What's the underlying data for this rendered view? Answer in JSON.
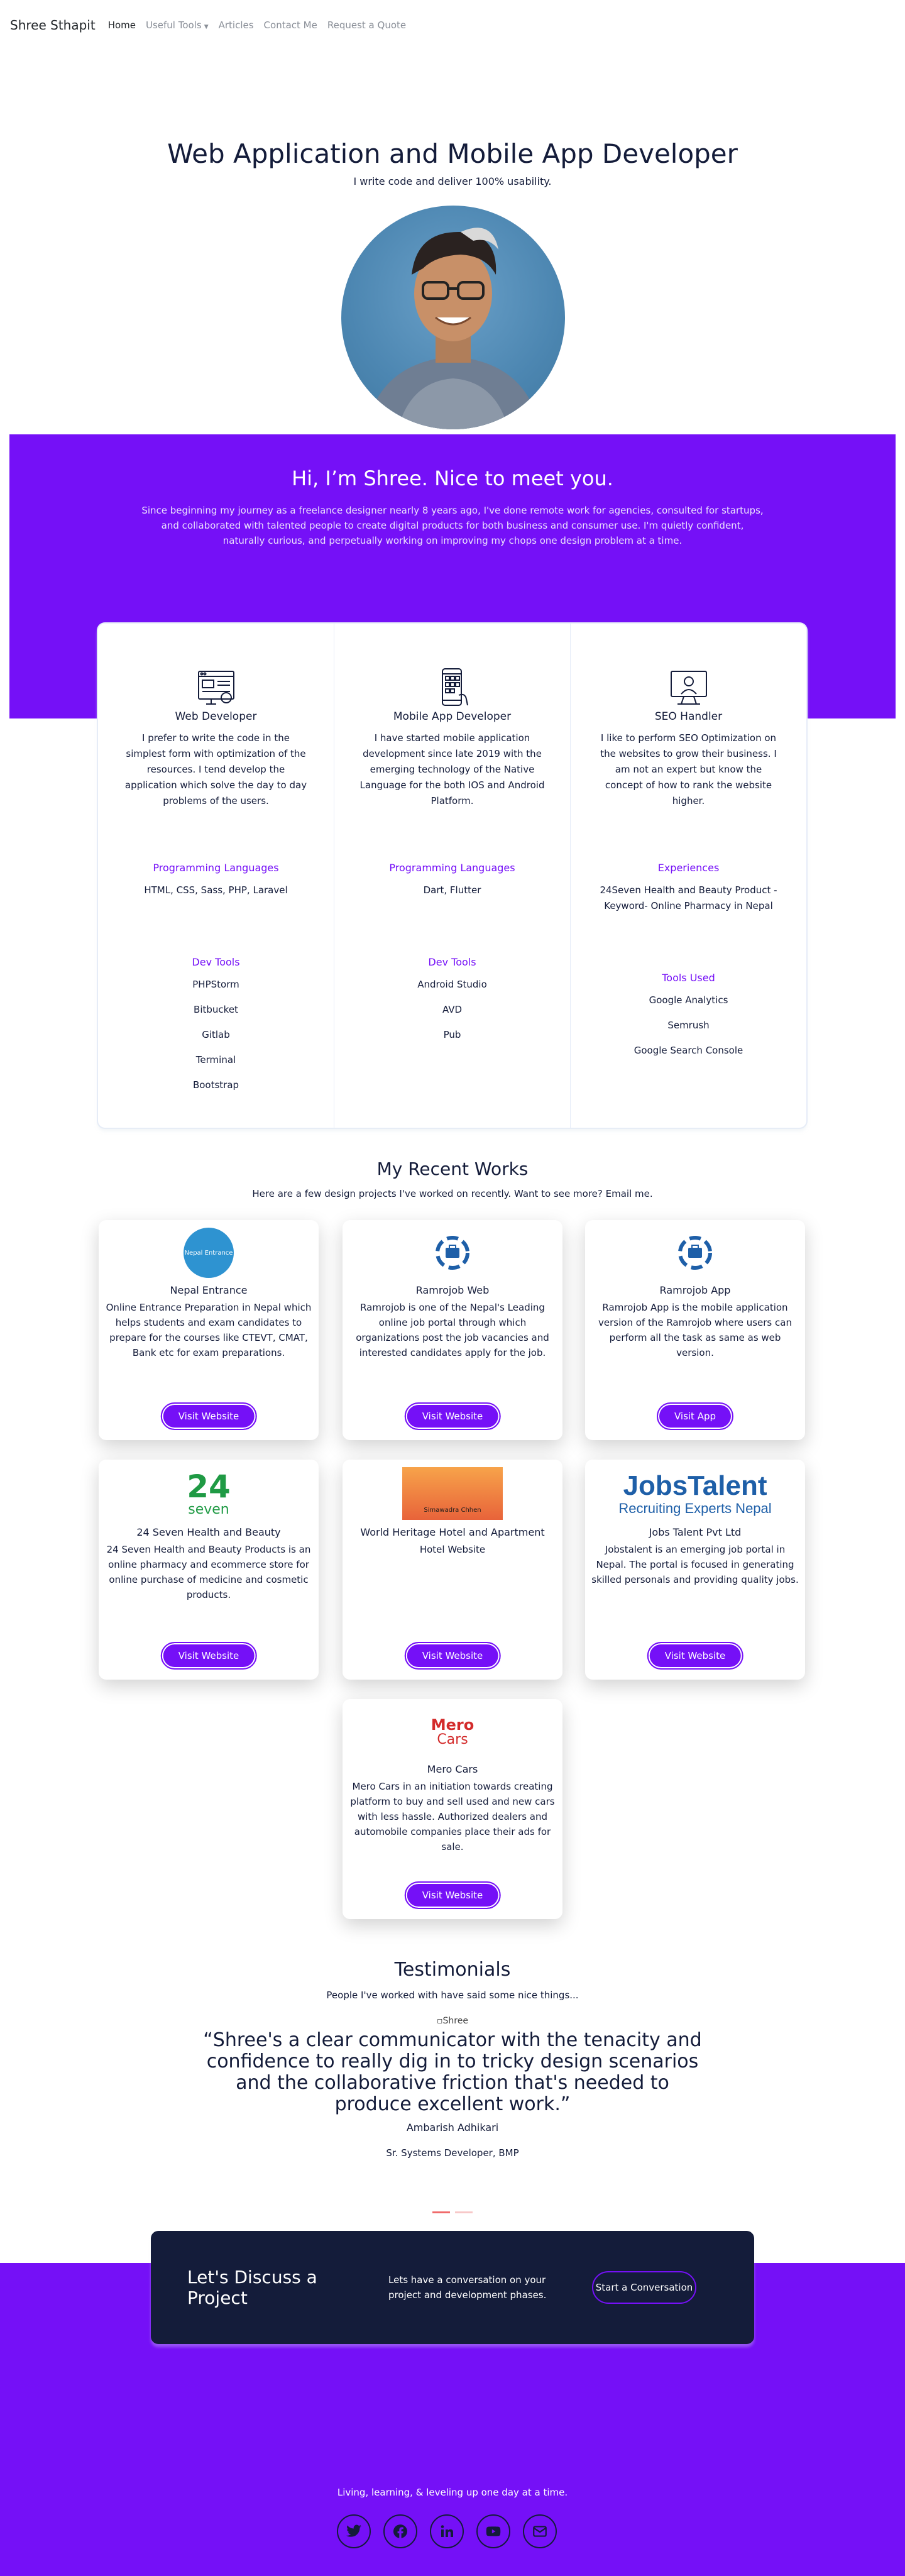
{
  "nav": {
    "brand": "Shree Sthapit",
    "items": [
      {
        "label": "Home",
        "active": true
      },
      {
        "label": "Useful Tools",
        "dropdown": true
      },
      {
        "label": "Articles"
      },
      {
        "label": "Contact Me"
      },
      {
        "label": "Request a Quote"
      }
    ]
  },
  "hero": {
    "title": "Web Application and Mobile App Developer",
    "tagline": "I write code and deliver 100% usability."
  },
  "intro": {
    "title": "Hi, I’m Shree. Nice to meet you.",
    "text": "Since beginning my journey as a freelance designer nearly 8 years ago, I've done remote work for agencies, consulted for startups, and collaborated with talented people to create digital products for both business and consumer use. I'm quietly confident, naturally curious, and perpetually working on improving my chops one design problem at a time."
  },
  "skills": [
    {
      "icon": "web-developer-icon",
      "title": "Web Developer",
      "desc": "I prefer to write the code in the simplest form with optimization of the resources. I tend develop the application which solve the day to day problems of the users.",
      "sub1": "Programming Languages",
      "sub1_text": "HTML, CSS, Sass, PHP, Laravel",
      "sub2": "Dev Tools",
      "list": [
        "PHPStorm",
        "Bitbucket",
        "Gitlab",
        "Terminal",
        "Bootstrap"
      ]
    },
    {
      "icon": "mobile-developer-icon",
      "title": "Mobile App Developer",
      "desc": "I have started mobile application development since late 2019 with the emerging technology of the Native Language for the both IOS and Android Platform.",
      "sub1": "Programming Languages",
      "sub1_text": "Dart, Flutter",
      "sub2": "Dev Tools",
      "list": [
        "Android Studio",
        "AVD",
        "Pub"
      ]
    },
    {
      "icon": "seo-icon",
      "title": "SEO Handler",
      "desc": "I like to perform SEO Optimization on the websites to grow their business. I am not an expert but know the concept of how to rank the website higher.",
      "sub1": "Experiences",
      "sub1_text": "24Seven Health and Beauty Product - Keyword- Online Pharmacy in Nepal",
      "sub2": "Tools Used",
      "list": [
        "Google Analytics",
        "Semrush",
        "Google Search Console"
      ]
    }
  ],
  "works": {
    "title": "My Recent Works",
    "subtitle": "Here are a few design projects I've worked on recently. Want to see more? Email me.",
    "items": [
      {
        "title": "Nepal Entrance",
        "desc": "Online Entrance Preparation in Nepal which helps students and exam candidates to prepare for the courses like CTEVT, CMAT, Bank etc for exam preparations.",
        "button": "Visit Website",
        "logo": "nepal-entrance-logo",
        "logo_text": "Nepal Entrance"
      },
      {
        "title": "Ramrojob Web",
        "desc": "Ramrojob is one of the Nepal's Leading online job portal through which organizations post the job vacancies and interested candidates apply for the job.",
        "button": "Visit Website",
        "logo": "ramrojob-logo"
      },
      {
        "title": "Ramrojob App",
        "desc": "Ramrojob App is the mobile application version of the Ramrojob where users can perform all the task as same as web version.",
        "button": "Visit App",
        "logo": "ramrojob-logo"
      },
      {
        "title": "24 Seven Health and Beauty",
        "desc": "24 Seven Health and Beauty Products is an online pharmacy and ecommerce store for online purchase of medicine and cosmetic products.",
        "button": "Visit Website",
        "logo": "24seven-logo",
        "logo_text": "24",
        "logo_text2": "seven"
      },
      {
        "title": "World Heritage Hotel and Apartment",
        "desc": "Hotel Website",
        "button": "Visit Website",
        "logo": "world-heritage-logo",
        "logo_text": "Simawadra Chhen"
      },
      {
        "title": "Jobs Talent Pvt Ltd",
        "desc": "Jobstalent is an emerging job portal in Nepal. The portal is focused in generating skilled personals and providing quality jobs.",
        "button": "Visit Website",
        "logo": "jobstalent-logo",
        "logo_text": "JobsTalent",
        "logo_text2": "Recruiting Experts Nepal"
      },
      {
        "title": "Mero Cars",
        "desc": "Mero Cars in an initiation towards creating platform to buy and sell used and new cars with less hassle. Authorized dealers and automobile companies place their ads for sale.",
        "button": "Visit Website",
        "logo": "mero-cars-logo",
        "logo_text": "Mero",
        "logo_text2": "Cars"
      }
    ]
  },
  "testimonials": {
    "title": "Testimonials",
    "subtitle": "People I've worked with have said some nice things...",
    "img_alt": "Shree",
    "quote": "“Shree's a clear communicator with the tenacity and confidence to really dig in to tricky design scenarios and the collaborative friction that's needed to produce excellent work.”",
    "name": "Ambarish Adhikari",
    "role": "Sr. Systems Developer, BMP"
  },
  "cta": {
    "title": "Let's Discuss a Project",
    "desc": "Lets have a conversation on your project and development phases.",
    "button": "Start a Conversation"
  },
  "footer": {
    "text": "Living, learning, & leveling up one day at a time.",
    "socials": [
      "twitter-icon",
      "facebook-icon",
      "linkedin-icon",
      "youtube-icon",
      "email-icon"
    ]
  },
  "colors": {
    "accent": "#7510f7",
    "dark": "#141c3a",
    "white": "#ffffff"
  }
}
